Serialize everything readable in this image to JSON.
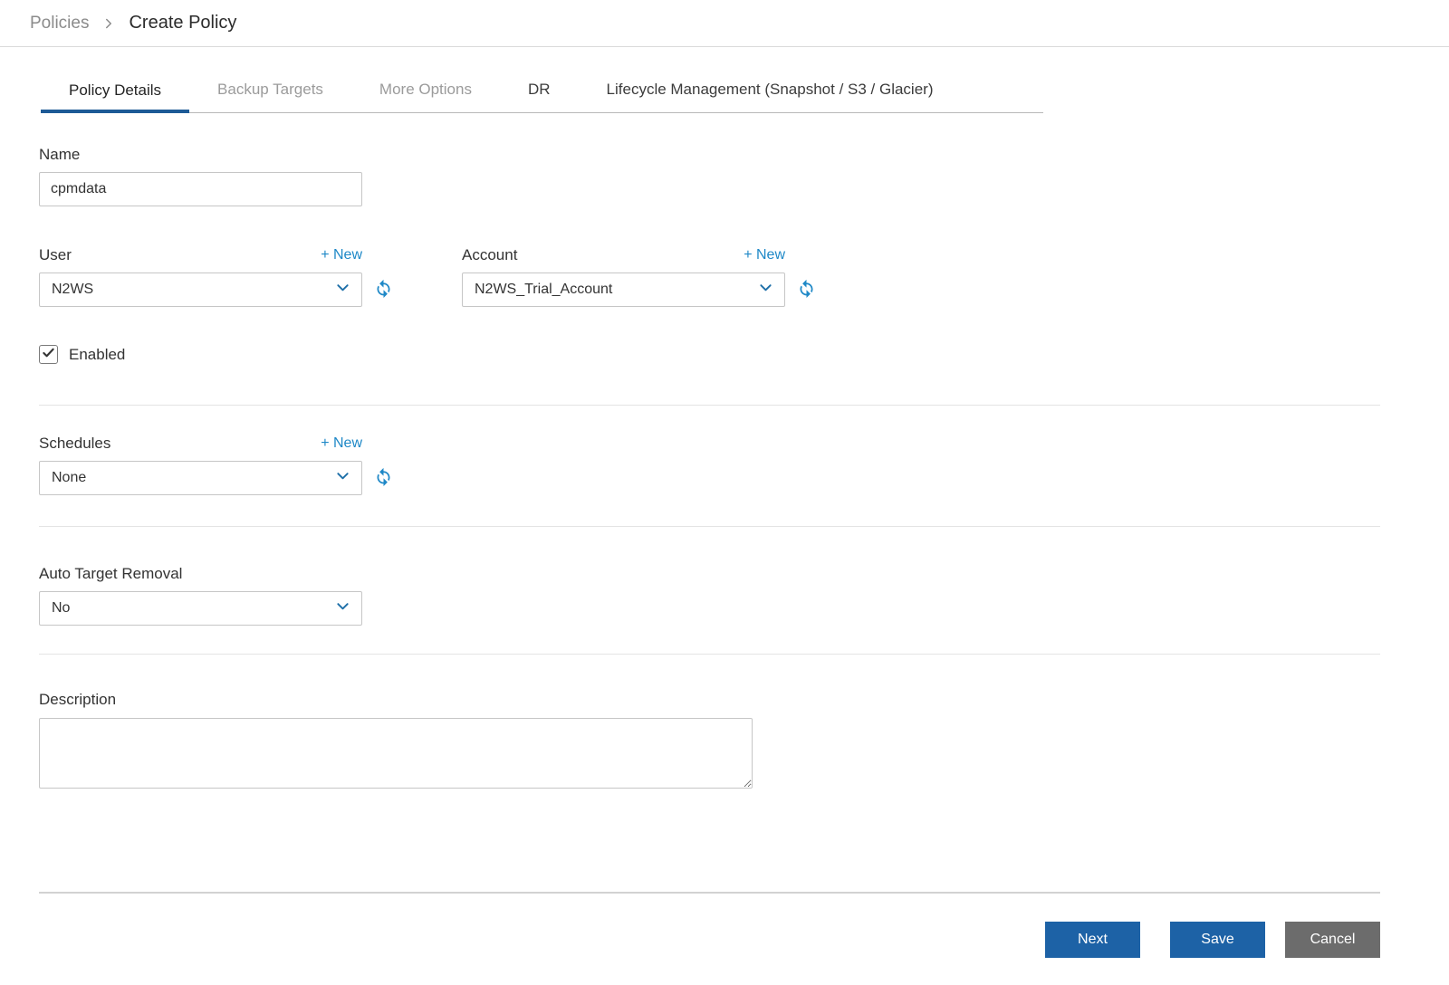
{
  "breadcrumb": {
    "parent": "Policies",
    "current": "Create Policy"
  },
  "tabs": [
    {
      "label": "Policy Details",
      "active": true
    },
    {
      "label": "Backup Targets",
      "active": false
    },
    {
      "label": "More Options",
      "active": false
    },
    {
      "label": "DR",
      "active": false
    },
    {
      "label": "Lifecycle Management (Snapshot / S3 / Glacier)",
      "active": false
    }
  ],
  "form": {
    "name": {
      "label": "Name",
      "value": "cpmdata"
    },
    "user": {
      "label": "User",
      "new_link": "+ New",
      "selected": "N2WS"
    },
    "account": {
      "label": "Account",
      "new_link": "+ New",
      "selected": "N2WS_Trial_Account"
    },
    "enabled": {
      "label": "Enabled",
      "checked": true
    },
    "schedules": {
      "label": "Schedules",
      "new_link": "+ New",
      "selected": "None"
    },
    "auto_target_removal": {
      "label": "Auto Target Removal",
      "selected": "No"
    },
    "description": {
      "label": "Description",
      "value": ""
    }
  },
  "footer": {
    "next": "Next",
    "save": "Save",
    "cancel": "Cancel"
  },
  "colors": {
    "accent_blue": "#1d5a96",
    "button_blue": "#1d62a6",
    "link_blue": "#1e88c7",
    "cancel_gray": "#6c6c6c"
  }
}
